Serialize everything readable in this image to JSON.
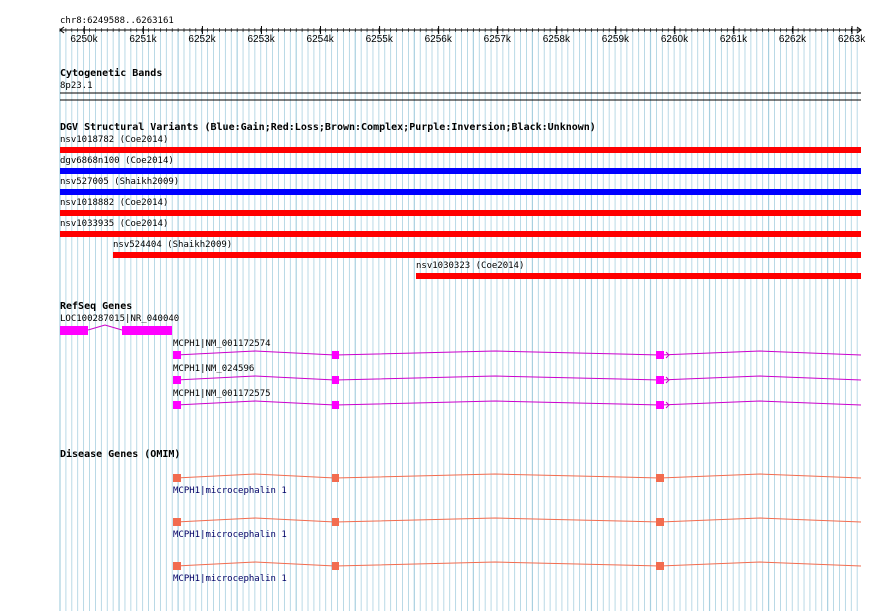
{
  "ruler": {
    "range_label": "chr8:6249588..6263161",
    "ticks": [
      {
        "label": "6250k",
        "pos": 6250000
      },
      {
        "label": "6251k",
        "pos": 6251000
      },
      {
        "label": "6252k",
        "pos": 6252000
      },
      {
        "label": "6253k",
        "pos": 6253000
      },
      {
        "label": "6254k",
        "pos": 6254000
      },
      {
        "label": "6255k",
        "pos": 6255000
      },
      {
        "label": "6256k",
        "pos": 6256000
      },
      {
        "label": "6257k",
        "pos": 6257000
      },
      {
        "label": "6258k",
        "pos": 6258000
      },
      {
        "label": "6259k",
        "pos": 6259000
      },
      {
        "label": "6260k",
        "pos": 6260000
      },
      {
        "label": "6261k",
        "pos": 6261000
      },
      {
        "label": "6262k",
        "pos": 6262000
      },
      {
        "label": "6263k",
        "pos": 6263000
      }
    ]
  },
  "cytobands": {
    "title": "Cytogenetic Bands",
    "band": "8p23.1"
  },
  "dgv": {
    "title": "DGV Structural Variants (Blue:Gain;Red:Loss;Brown:Complex;Purple:Inversion;Black:Unknown)",
    "variants": [
      {
        "label": "nsv1018782 (Coe2014)",
        "color": "#ff0000"
      },
      {
        "label": "dgv6868n100 (Coe2014)",
        "color": "#0000ff"
      },
      {
        "label": "nsv527005 (Shaikh2009)",
        "color": "#0000ff"
      },
      {
        "label": "nsv1018882 (Coe2014)",
        "color": "#ff0000"
      },
      {
        "label": "nsv1033935 (Coe2014)",
        "color": "#ff0000"
      },
      {
        "label": "nsv524404 (Shaikh2009)",
        "color": "#ff0000"
      },
      {
        "label": "nsv1030323 (Coe2014)",
        "color": "#ff0000"
      }
    ]
  },
  "refseq": {
    "title": "RefSeq Genes",
    "color": "#ff00ff",
    "intron_color": "#cc00cc",
    "genes": [
      {
        "label": "LOC100287015|NR_040040"
      },
      {
        "label": "MCPH1|NM_001172574"
      },
      {
        "label": "MCPH1|NM_024596"
      },
      {
        "label": "MCPH1|NM_001172575"
      }
    ]
  },
  "omim": {
    "title": "Disease Genes (OMIM)",
    "color": "#f26c4f",
    "genes": [
      {
        "label": "MCPH1|microcephalin 1"
      },
      {
        "label": "MCPH1|microcephalin 1"
      },
      {
        "label": "MCPH1|microcephalin 1"
      }
    ]
  },
  "colors": {
    "grid": "#a8d0e0",
    "axis": "#000000"
  }
}
